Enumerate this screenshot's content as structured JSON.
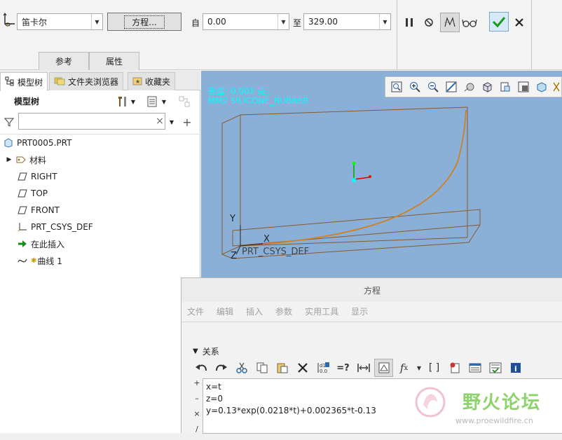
{
  "ribbon": {
    "coord_type": "笛卡尔",
    "equation_button": "方程...",
    "from_label": "自",
    "from_value": "0.00",
    "to_label": "至",
    "to_value": "329.00",
    "tabs": [
      "参考",
      "属性"
    ]
  },
  "left_panel": {
    "tabs": [
      {
        "label": "模型树",
        "icon": "model-tree-icon"
      },
      {
        "label": "文件夹浏览器",
        "icon": "folder-browser-icon"
      },
      {
        "label": "收藏夹",
        "icon": "favorites-icon"
      }
    ],
    "tree_title": "模型树",
    "search_placeholder": "",
    "items": [
      {
        "label": "PRT0005.PRT",
        "icon": "part-icon"
      },
      {
        "label": "材料",
        "icon": "material-icon"
      },
      {
        "label": "RIGHT",
        "icon": "datum-plane-icon"
      },
      {
        "label": "TOP",
        "icon": "datum-plane-icon"
      },
      {
        "label": "FRONT",
        "icon": "datum-plane-icon"
      },
      {
        "label": "PRT_CSYS_DEF",
        "icon": "csys-icon"
      },
      {
        "label": "在此插入",
        "icon": "insert-here-icon"
      },
      {
        "label": "曲线 1",
        "icon": "curve-icon"
      }
    ]
  },
  "viewport": {
    "info_line1": "密度: 0.001 克",
    "info_line2": "MM2 SILICONE_RUBBER",
    "axis_x": "X",
    "axis_y": "Y",
    "axis_z": "Z",
    "csys_label": "PRT_CSYS_DEF"
  },
  "dialog": {
    "title": "方程",
    "menu": [
      "文件",
      "编辑",
      "插入",
      "参数",
      "实用工具",
      "显示"
    ],
    "section": "关系",
    "gutter": [
      "+",
      "–",
      "×",
      "/"
    ],
    "lines": [
      "x=t",
      "z=0",
      "y=0.13*exp(0.0218*t)+0.002365*t-0.13"
    ]
  },
  "watermark": {
    "text": "野火论坛",
    "url": "www.proewildfire.cn"
  }
}
